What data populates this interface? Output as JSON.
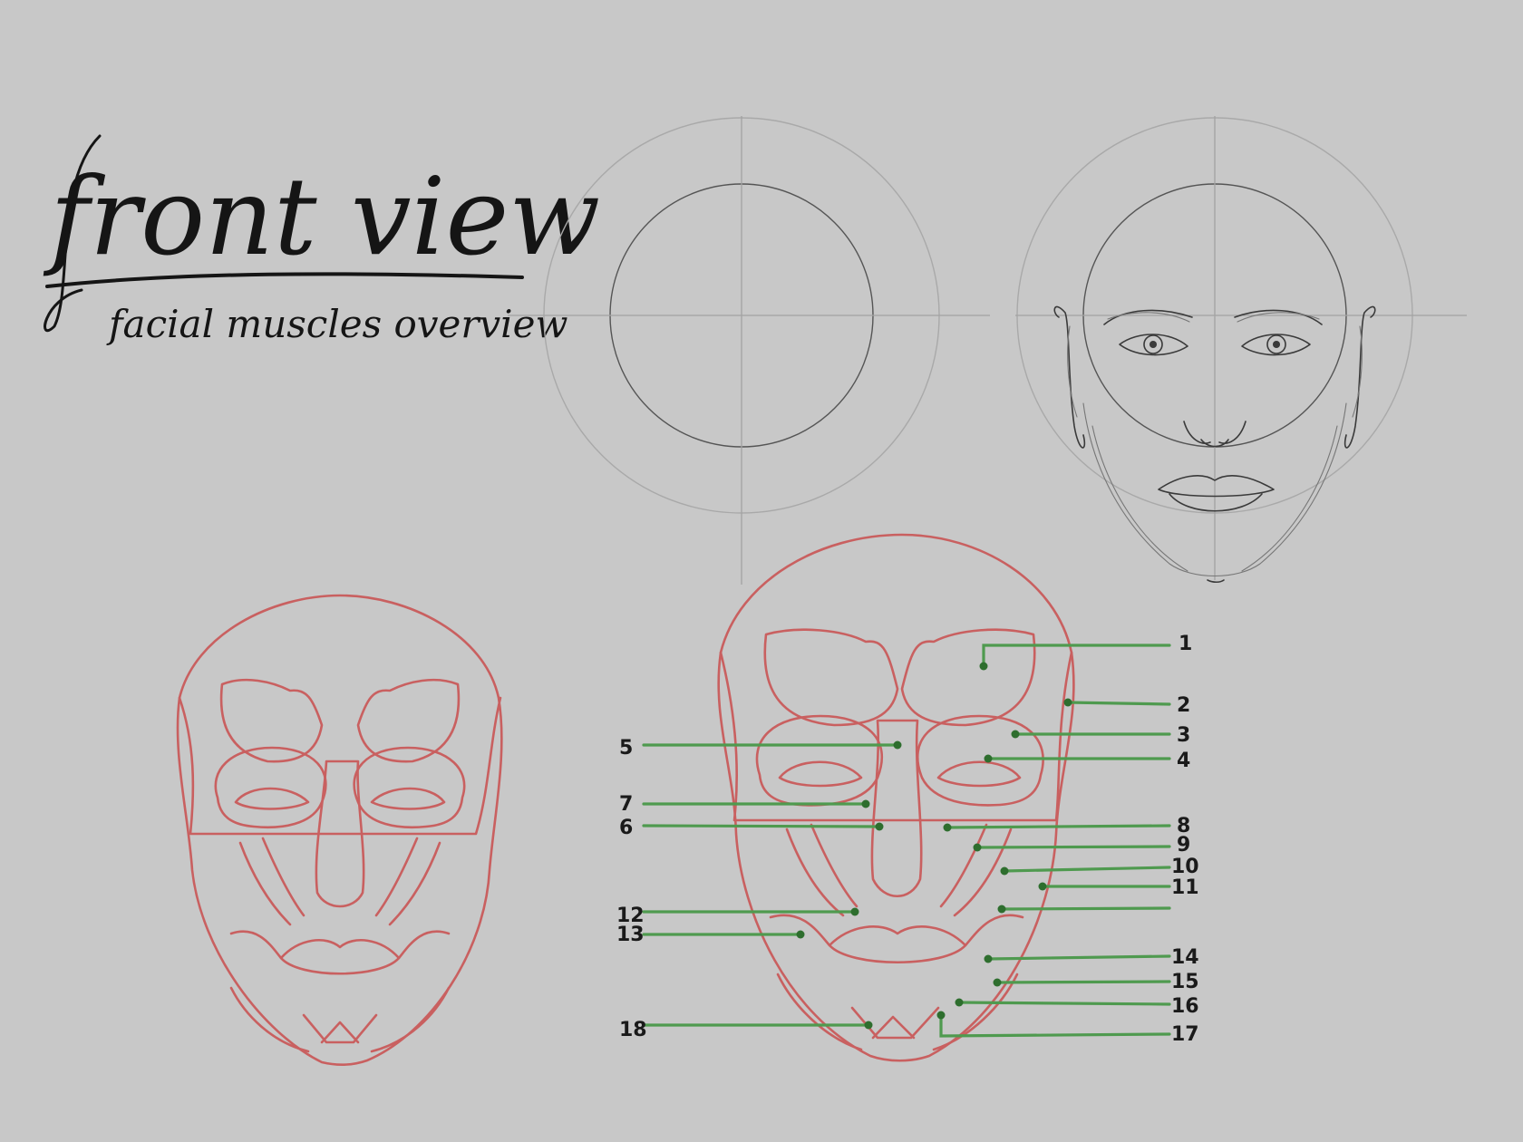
{
  "title": "front view",
  "subtitle": "facial muscles overview",
  "colors": {
    "background": "#c8c8c8",
    "muscle_outline": "#c96060",
    "leader_line": "#4f9a4f",
    "ink": "#151515"
  },
  "labels": [
    "1",
    "2",
    "3",
    "4",
    "5",
    "6",
    "7",
    "8",
    "9",
    "10",
    "11",
    "12",
    "13",
    "14",
    "15",
    "16",
    "17",
    "18"
  ]
}
